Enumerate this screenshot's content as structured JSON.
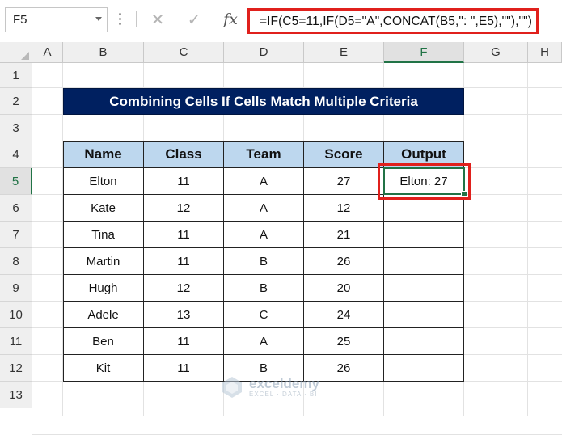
{
  "formula_bar": {
    "name_box": "F5",
    "cancel_icon": "✕",
    "enter_icon": "✓",
    "fx_label": "fx",
    "formula": "=IF(C5=11,IF(D5=\"A\",CONCAT(B5,\": \",E5),\"\"),\"\")"
  },
  "columns": [
    "A",
    "B",
    "C",
    "D",
    "E",
    "F",
    "G",
    "H"
  ],
  "rows": [
    "1",
    "2",
    "3",
    "4",
    "5",
    "6",
    "7",
    "8",
    "9",
    "10",
    "11",
    "12",
    "13"
  ],
  "selected": {
    "column": "F",
    "row": "5"
  },
  "title": "Combining Cells If Cells Match Multiple Criteria",
  "table": {
    "headers": [
      "Name",
      "Class",
      "Team",
      "Score",
      "Output"
    ],
    "rows": [
      [
        "Elton",
        "11",
        "A",
        "27",
        "Elton: 27"
      ],
      [
        "Kate",
        "12",
        "A",
        "12",
        ""
      ],
      [
        "Tina",
        "11",
        "A",
        "21",
        ""
      ],
      [
        "Martin",
        "11",
        "B",
        "26",
        ""
      ],
      [
        "Hugh",
        "12",
        "B",
        "20",
        ""
      ],
      [
        "Adele",
        "13",
        "C",
        "24",
        ""
      ],
      [
        "Ben",
        "11",
        "A",
        "25",
        ""
      ],
      [
        "Kit",
        "11",
        "B",
        "26",
        ""
      ]
    ]
  },
  "colors": {
    "title_bg": "#002060",
    "header_bg": "#bdd7ee",
    "highlight": "#e0201c",
    "selection": "#217346"
  },
  "watermark": {
    "name": "exceldemy",
    "tagline": "EXCEL · DATA · BI"
  }
}
